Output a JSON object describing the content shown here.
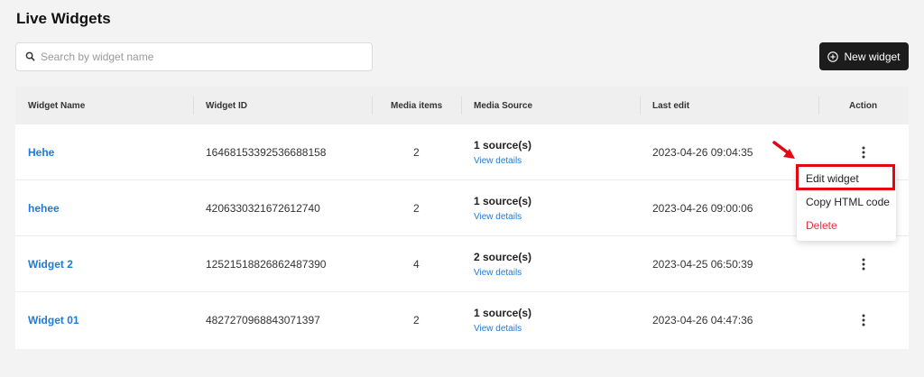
{
  "page": {
    "title": "Live Widgets"
  },
  "search": {
    "placeholder": "Search by widget name",
    "value": ""
  },
  "toolbar": {
    "new_widget_label": "New widget"
  },
  "table": {
    "columns": [
      "Widget Name",
      "Widget ID",
      "Media items",
      "Media Source",
      "Last edit",
      "Action"
    ],
    "rows": [
      {
        "name": "Hehe",
        "id": "16468153392536688158",
        "media_items": "2",
        "source_count": "1 source(s)",
        "source_link": "View details",
        "last_edit": "2023-04-26 09:04:35"
      },
      {
        "name": "hehee",
        "id": "4206330321672612740",
        "media_items": "2",
        "source_count": "1 source(s)",
        "source_link": "View details",
        "last_edit": "2023-04-26 09:00:06"
      },
      {
        "name": "Widget 2",
        "id": "12521518826862487390",
        "media_items": "4",
        "source_count": "2 source(s)",
        "source_link": "View details",
        "last_edit": "2023-04-25 06:50:39"
      },
      {
        "name": "Widget 01",
        "id": "4827270968843071397",
        "media_items": "2",
        "source_count": "1 source(s)",
        "source_link": "View details",
        "last_edit": "2023-04-26 04:47:36"
      }
    ]
  },
  "action_menu": {
    "items": [
      "Edit widget",
      "Copy HTML code",
      "Delete"
    ],
    "highlighted": "Edit widget"
  },
  "icons": {
    "search": "search-icon",
    "new_widget": "plus-circle-icon",
    "row_action": "kebab-menu-icon",
    "annotation": "red-arrow-icon"
  },
  "colors": {
    "background": "#f3f3f3",
    "primary_button": "#1c1c1c",
    "link": "#1f7ad8",
    "danger": "#e0313c",
    "highlight": "#e30613"
  }
}
